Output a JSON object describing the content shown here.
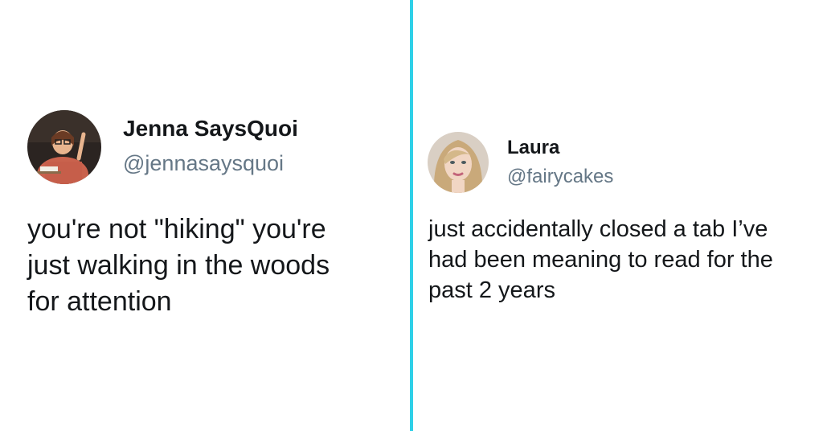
{
  "tweets": [
    {
      "display_name": "Jenna SaysQuoi",
      "handle": "@jennasaysquoi",
      "text": "you're not \"hiking\" you're\njust walking in the woods\nfor attention"
    },
    {
      "display_name": "Laura",
      "handle": "@fairycakes",
      "text": "just accidentally closed a tab I’ve\nhad been meaning to read for the\npast 2 years"
    }
  ],
  "colors": {
    "divider": "#2fd0e8",
    "handle": "#657786",
    "text": "#14171a",
    "background": "#ffffff"
  },
  "icons": {
    "left_avatar": "profile-photo",
    "right_avatar": "profile-photo"
  }
}
